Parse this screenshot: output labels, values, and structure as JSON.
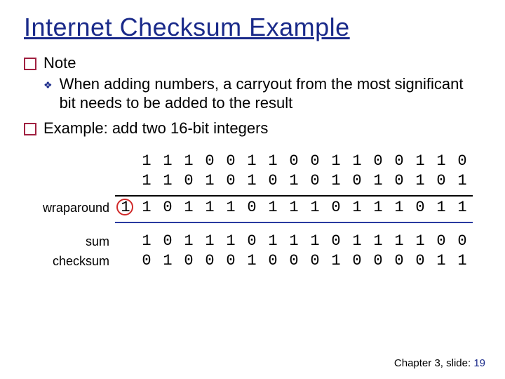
{
  "title": "Internet Checksum Example",
  "bullets": {
    "note": "Note",
    "note_sub": "When adding numbers, a carryout from the most significant bit needs to be added to the result",
    "example": "Example: add two 16-bit integers"
  },
  "labels": {
    "wraparound": "wraparound",
    "sum": "sum",
    "checksum": "checksum"
  },
  "rows": {
    "a": [
      "",
      "1",
      "1",
      "1",
      "0",
      "0",
      "1",
      "1",
      "0",
      "0",
      "1",
      "1",
      "0",
      "0",
      "1",
      "1",
      "0"
    ],
    "b": [
      "",
      "1",
      "1",
      "0",
      "1",
      "0",
      "1",
      "0",
      "1",
      "0",
      "1",
      "0",
      "1",
      "0",
      "1",
      "0",
      "1"
    ],
    "wrap": [
      "1",
      "1",
      "0",
      "1",
      "1",
      "1",
      "0",
      "1",
      "1",
      "1",
      "0",
      "1",
      "1",
      "1",
      "0",
      "1",
      "1"
    ],
    "sum": [
      "",
      "1",
      "0",
      "1",
      "1",
      "1",
      "0",
      "1",
      "1",
      "1",
      "0",
      "1",
      "1",
      "1",
      "1",
      "0",
      "0"
    ],
    "chk": [
      "",
      "0",
      "1",
      "0",
      "0",
      "0",
      "1",
      "0",
      "0",
      "0",
      "1",
      "0",
      "0",
      "0",
      "0",
      "1",
      "1"
    ]
  },
  "footer": {
    "text": "Chapter 3, slide:",
    "page": "19"
  },
  "chart_data": {
    "type": "table",
    "title": "Internet Checksum Example — add two 16-bit integers with wraparound carry",
    "operands_binary": [
      "1110011001100110",
      "1101010101010101"
    ],
    "raw_sum_17bit": "11011101110111011",
    "carry_bit": 1,
    "sum_after_wraparound": "1011101110111100",
    "checksum_ones_complement": "0100010001000011"
  }
}
